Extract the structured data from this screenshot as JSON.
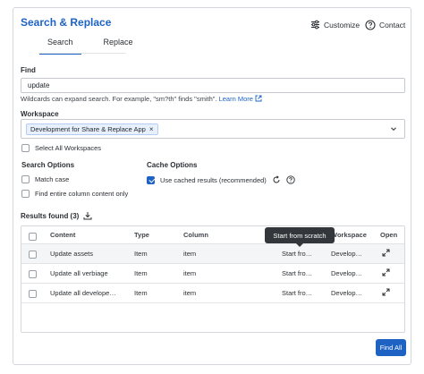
{
  "header": {
    "title": "Search & Replace",
    "customize_label": "Customize",
    "contact_label": "Contact"
  },
  "tabs": [
    {
      "label": "Search",
      "active": true
    },
    {
      "label": "Replace",
      "active": false
    }
  ],
  "find": {
    "label": "Find",
    "value": "update",
    "help_text": "Wildcards can expand search. For example, \"sm?th\" finds \"smith\".",
    "learn_more": "Learn More"
  },
  "workspace": {
    "label": "Workspace",
    "selected": "Development for Share & Replace App",
    "select_all_label": "Select All Workspaces",
    "select_all_checked": false
  },
  "search_options": {
    "title": "Search Options",
    "match_case": {
      "label": "Match case",
      "checked": false
    },
    "entire_column": {
      "label": "Find entire column content only",
      "checked": false
    }
  },
  "cache_options": {
    "title": "Cache Options",
    "use_cached": {
      "label": "Use cached results (recommended)",
      "checked": true
    }
  },
  "results": {
    "label": "Results found (3)",
    "columns": {
      "content": "Content",
      "type": "Type",
      "column": "Column",
      "workspace": "Workspace",
      "open": "Open"
    },
    "rows": [
      {
        "content": "Update assets",
        "type": "Item",
        "column": "item",
        "sheet": "Start fro…",
        "workspace": "Develop…"
      },
      {
        "content": "Update all verbiage",
        "type": "Item",
        "column": "item",
        "sheet": "Start fro…",
        "workspace": "Develop…"
      },
      {
        "content": "Update all develope…",
        "type": "Item",
        "column": "item",
        "sheet": "Start fro…",
        "workspace": "Develop…"
      }
    ],
    "tooltip": "Start from scratch"
  },
  "find_all_label": "Find All",
  "colors": {
    "accent": "#1e63c4",
    "tooltip_bg": "#33373b"
  }
}
